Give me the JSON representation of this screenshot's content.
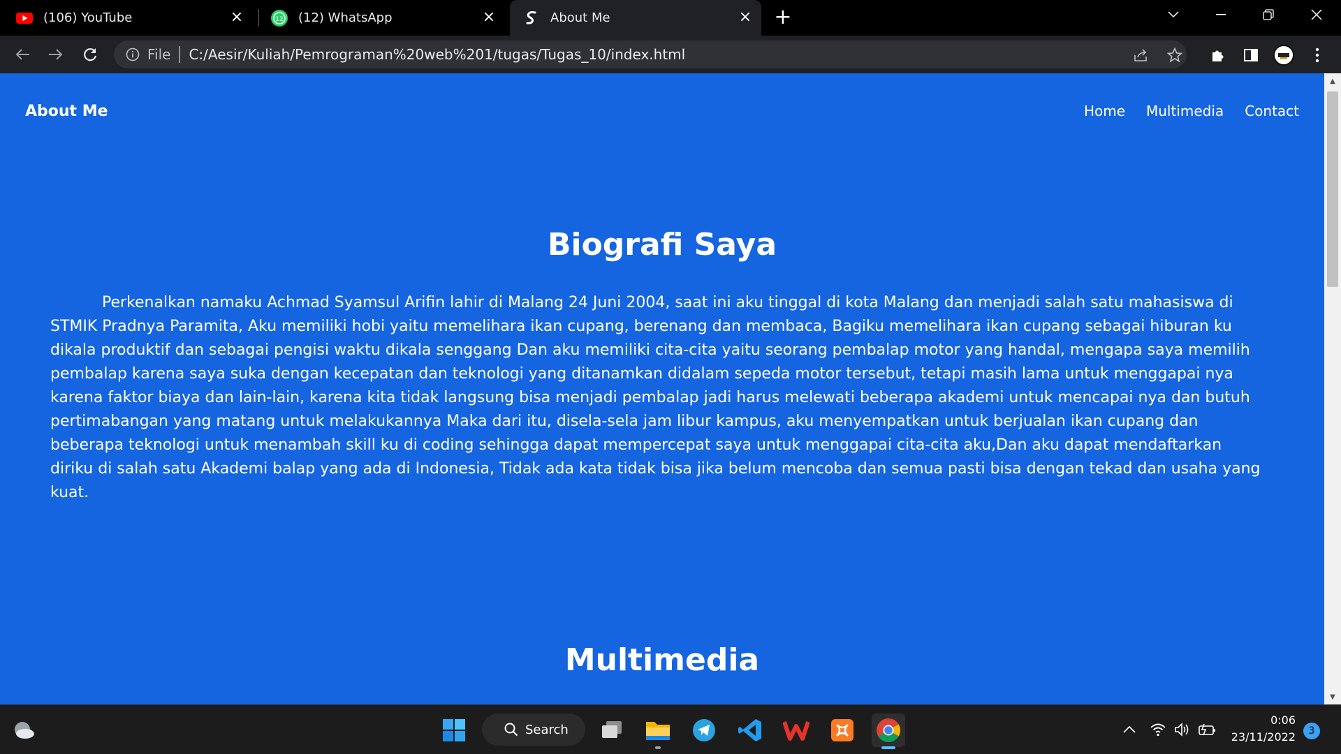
{
  "browser": {
    "tabs": [
      {
        "title": "(106) YouTube",
        "icon": "youtube-icon"
      },
      {
        "title": "(12) WhatsApp",
        "icon": "whatsapp-icon"
      },
      {
        "title": "About Me",
        "icon": "site-favicon-icon",
        "active": true
      }
    ],
    "address": {
      "scheme_label": "File",
      "url": "C:/Aesir/Kuliah/Pemrograman%20web%201/tugas/Tugas_10/index.html"
    }
  },
  "page": {
    "brand": "About Me",
    "nav": [
      "Home",
      "Multimedia",
      "Contact"
    ],
    "bio_heading": "Biografi Saya",
    "bio_text": "Perkenalkan namaku Achmad Syamsul Arifin lahir di Malang 24 Juni 2004, saat ini aku tinggal di kota Malang dan menjadi salah satu mahasiswa di STMIK Pradnya Paramita, Aku memiliki hobi yaitu memelihara ikan cupang, berenang dan membaca, Bagiku memelihara ikan cupang sebagai hiburan ku dikala produktif dan sebagai pengisi waktu dikala senggang Dan aku memiliki cita-cita yaitu seorang pembalap motor yang handal, mengapa saya memilih pembalap karena saya suka dengan kecepatan dan teknologi yang ditanamkan didalam sepeda motor tersebut, tetapi masih lama untuk menggapai nya karena faktor biaya dan lain-lain, karena kita tidak langsung bisa menjadi pembalap jadi harus melewati beberapa akademi untuk mencapai nya dan butuh pertimabangan yang matang untuk melakukannya Maka dari itu, disela-sela jam libur kampus, aku menyempatkan untuk berjualan ikan cupang dan beberapa teknologi untuk menambah skill ku di coding sehingga dapat mempercepat saya untuk menggapai cita-cita aku,Dan aku dapat mendaftarkan diriku di salah satu Akademi balap yang ada di Indonesia, Tidak ada kata tidak bisa jika belum mencoba dan semua pasti bisa dengan tekad dan usaha yang kuat.",
    "multimedia_heading": "Multimedia",
    "background_color": "#1565e0"
  },
  "taskbar": {
    "search_label": "Search",
    "time": "0:06",
    "date": "23/11/2022",
    "notification_count": "3"
  }
}
